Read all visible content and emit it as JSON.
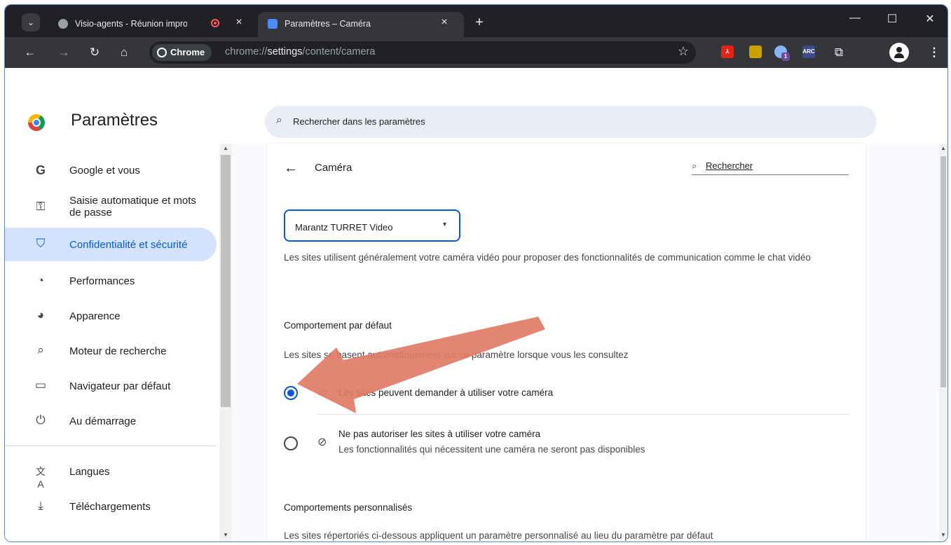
{
  "browser": {
    "tabs": [
      {
        "title": "Visio-agents - Réunion improvisée",
        "close": "×"
      },
      {
        "title": "Paramètres – Caméra",
        "close": "×"
      }
    ],
    "new_tab": "+",
    "window_controls": {
      "minimize": "—",
      "maximize": "☐",
      "close": "✕"
    },
    "omnibox": {
      "chip": "Chrome",
      "url_scheme": "chrome://",
      "url_host": "settings",
      "url_path": "/content/camera"
    },
    "extensions": [
      {
        "name": "pdf-extension",
        "label": "",
        "color": "#e2231a"
      },
      {
        "name": "folder-extension",
        "label": "",
        "color": "#c9a200"
      },
      {
        "name": "globe-extension",
        "label": "1",
        "color": "#5f6368"
      },
      {
        "name": "arc-extension",
        "label": "ARC",
        "color": "#3c4a8c"
      }
    ]
  },
  "settings_header": {
    "title": "Paramètres",
    "search_placeholder": "Rechercher dans les paramètres"
  },
  "sidebar": {
    "items": [
      {
        "icon": "google-icon",
        "label": "Google et vous",
        "active": false
      },
      {
        "icon": "key-icon",
        "label": "Saisie automatique et mots de passe",
        "active": false
      },
      {
        "icon": "shield-icon",
        "label": "Confidentialité et sécurité",
        "active": true
      },
      {
        "icon": "speedometer-icon",
        "label": "Performances",
        "active": false
      },
      {
        "icon": "palette-icon",
        "label": "Apparence",
        "active": false
      },
      {
        "icon": "search-icon",
        "label": "Moteur de recherche",
        "active": false
      },
      {
        "icon": "browser-window-icon",
        "label": "Navigateur par défaut",
        "active": false
      },
      {
        "icon": "power-icon",
        "label": "Au démarrage",
        "active": false
      },
      {
        "icon": "translate-icon",
        "label": "Langues",
        "active": false
      },
      {
        "icon": "download-icon",
        "label": "Téléchargements",
        "active": false
      }
    ]
  },
  "camera_page": {
    "title": "Caméra",
    "search_label": "Rechercher",
    "device_select": "Marantz TURRET Video",
    "description": "Les sites utilisent généralement votre caméra vidéo pour proposer des fonctionnalités de communication comme le chat vidéo",
    "default_behavior_heading": "Comportement par défaut",
    "default_behavior_text": "Les sites se basent automatiquement sur ce paramètre lorsque vous les consultez",
    "options": [
      {
        "icon": "camera-icon",
        "label": "Les sites peuvent demander à utiliser votre caméra",
        "sublabel": "",
        "selected": true
      },
      {
        "icon": "camera-off-icon",
        "label": "Ne pas autoriser les sites à utiliser votre caméra",
        "sublabel": "Les fonctionnalités qui nécessitent une caméra ne seront pas disponibles",
        "selected": false
      }
    ],
    "custom_heading": "Comportements personnalisés",
    "custom_text": "Les sites répertoriés ci-dessous appliquent un paramètre personnalisé au lieu du paramètre par défaut"
  },
  "annotation": {
    "type": "arrow",
    "color": "#e07b66",
    "points_to": "option-allow-radio"
  },
  "colors": {
    "accent": "#0b57d0",
    "active_nav_bg": "#d3e3fd",
    "tabbar_bg": "#1f2124",
    "toolbar_bg": "#35363a"
  }
}
